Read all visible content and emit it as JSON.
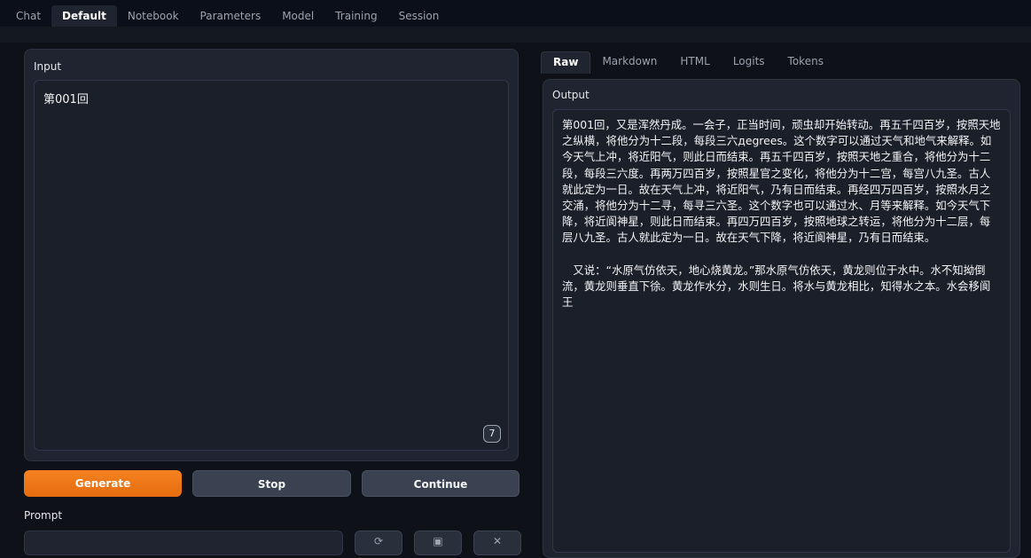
{
  "tabs": [
    "Chat",
    "Default",
    "Notebook",
    "Parameters",
    "Model",
    "Training",
    "Session"
  ],
  "active_tab": "Default",
  "input": {
    "label": "Input",
    "value": "第001回",
    "token_count": "7"
  },
  "buttons": {
    "generate": "Generate",
    "stop": "Stop",
    "continue": "Continue"
  },
  "prompt": {
    "label": "Prompt"
  },
  "output_tabs": [
    "Raw",
    "Markdown",
    "HTML",
    "Logits",
    "Tokens"
  ],
  "active_output_tab": "Raw",
  "output": {
    "label": "Output",
    "paragraph1": "第001回，又是浑然丹成。一会子，正当时间，顽虫却开始转动。再五千四百岁，按照天地之纵横，将他分为十二段，每段三六дegrees。这个数字可以通过天气和地气来解释。如今天气上冲，将近阳气，则此日而结束。再五千四百岁，按照天地之重合，将他分为十二段，每段三六度。再两万四百岁，按照星官之变化，将他分为十二宫，每宫八九圣。古人就此定为一日。故在天气上冲，将近阳气，乃有日而结束。再经四万四百岁，按照水月之交涌，将他分为十二寻，每寻三六圣。这个数字也可以通过水、月等来解释。如今天气下降，将近阆神星，则此日而结束。再四万四百岁，按照地球之转运，将他分为十二层，每层八九圣。古人就此定为一日。故在天气下降，将近阆神星，乃有日而结束。",
    "paragraph2": "又说：“水原气仿依天，地心烧黄龙。”那水原气仿依天，黄龙则位于水中。水不知拗倒流，黄龙则垂直下徐。黄龙作水分，水则生日。将水与黄龙相比，知得水之本。水会移阆王"
  },
  "colors": {
    "accent": "#f58220",
    "background": "#0e1117",
    "panel": "#1f2430"
  }
}
